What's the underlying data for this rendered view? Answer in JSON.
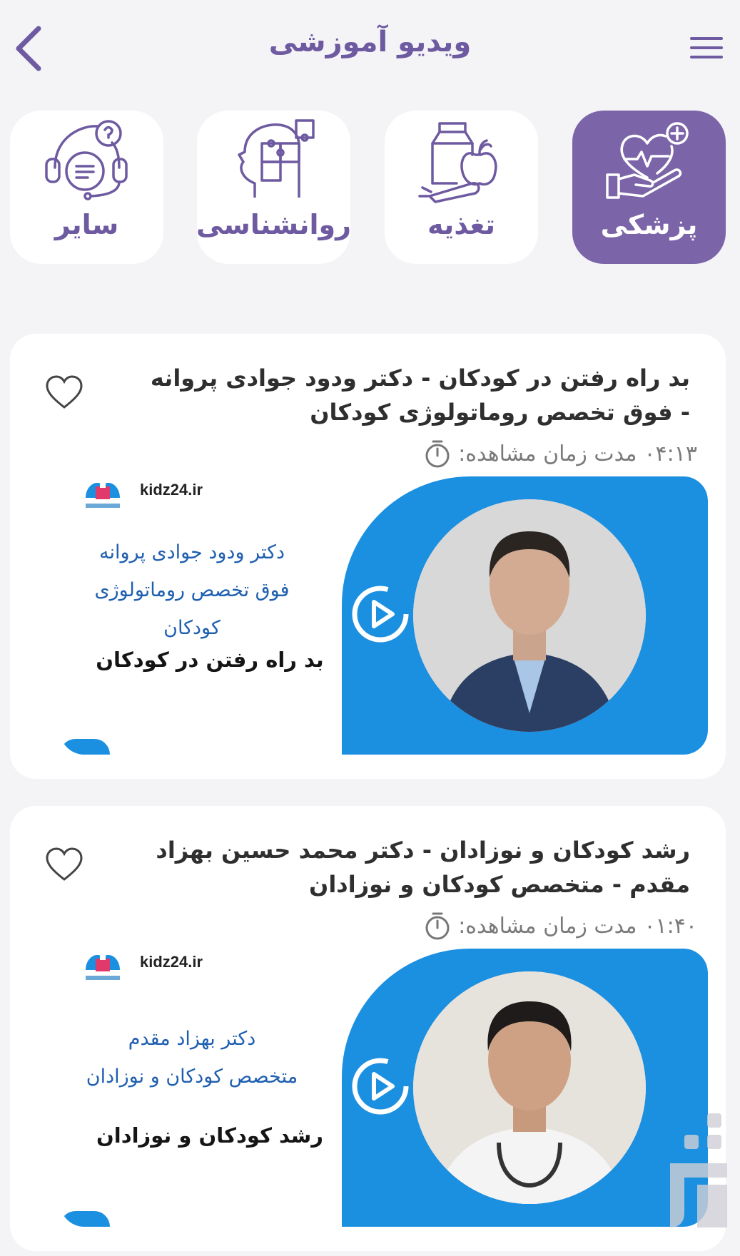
{
  "header": {
    "title": "ویدیو آموزشی"
  },
  "categories": [
    {
      "label": "پزشکی",
      "icon": "heart-hand-icon",
      "active": true
    },
    {
      "label": "تغذیه",
      "icon": "food-icon",
      "active": false
    },
    {
      "label": "روانشناسی",
      "icon": "head-puzzle-icon",
      "active": false
    },
    {
      "label": "سایر",
      "icon": "headset-question-icon",
      "active": false
    }
  ],
  "videos": [
    {
      "title": "بد راه رفتن در کودکان - دکتر ودود جوادی پروانه - فوق تخصص روماتولوژی کودکان",
      "duration_label": "مدت زمان مشاهده:",
      "duration_value": "۰۴:۱۳",
      "brand": "kidz24.ir",
      "doctor_lines": [
        "دکتر  ودود جوادی پروانه",
        "فوق تخصص روماتولوژی",
        "کودکان"
      ],
      "topic": "بد راه رفتن در کودکان"
    },
    {
      "title": "رشد کودکان و نوزادان - دکتر محمد حسین بهزاد مقدم - متخصص کودکان و نوزادان",
      "duration_label": "مدت زمان مشاهده:",
      "duration_value": "۰۱:۴۰",
      "brand": "kidz24.ir",
      "doctor_lines": [
        "دکتر بهزاد مقدم",
        "متخصص کودکان و نوزادان"
      ],
      "topic": "رشد کودکان و نوزادان"
    }
  ],
  "colors": {
    "primary": "#7b65a8",
    "accent_blue": "#1b8fe0",
    "background": "#f4f4f7"
  }
}
